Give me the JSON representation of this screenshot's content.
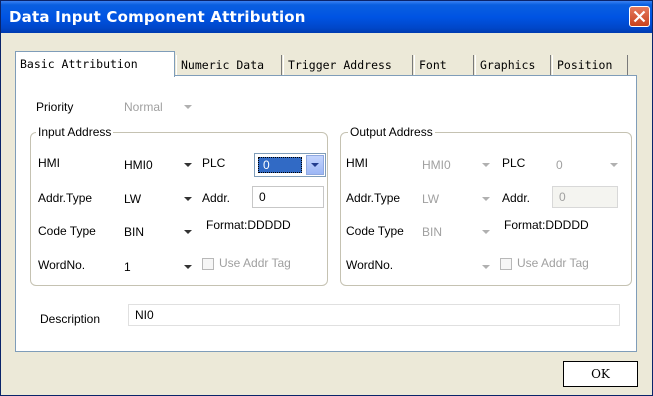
{
  "window": {
    "title": "Data Input Component Attribution"
  },
  "tabs": [
    {
      "label": "Basic Attribution"
    },
    {
      "label": "Numeric Data"
    },
    {
      "label": "Trigger Address"
    },
    {
      "label": "Font"
    },
    {
      "label": "Graphics"
    },
    {
      "label": "Position"
    }
  ],
  "priority": {
    "label": "Priority",
    "value": "Normal"
  },
  "input_address": {
    "legend": "Input Address",
    "hmi_label": "HMI",
    "hmi_value": "HMI0",
    "plc_label": "PLC",
    "plc_value": "0",
    "addr_type_label": "Addr.Type",
    "addr_type_value": "LW",
    "addr_label": "Addr.",
    "addr_value": "0",
    "code_type_label": "Code Type",
    "code_type_value": "BIN",
    "format_text": "Format:DDDDD",
    "word_no_label": "WordNo.",
    "word_no_value": "1",
    "use_addr_tag_label": "Use Addr Tag"
  },
  "output_address": {
    "legend": "Output Address",
    "hmi_label": "HMI",
    "hmi_value": "HMI0",
    "plc_label": "PLC",
    "plc_value": "0",
    "addr_type_label": "Addr.Type",
    "addr_type_value": "LW",
    "addr_label": "Addr.",
    "addr_value": "0",
    "code_type_label": "Code Type",
    "code_type_value": "BIN",
    "format_text": "Format:DDDDD",
    "word_no_label": "WordNo.",
    "word_no_value": "",
    "use_addr_tag_label": "Use Addr Tag"
  },
  "description": {
    "label": "Description",
    "value": "NI0"
  },
  "ok_label": "OK",
  "colors": {
    "titlebar": "#0054e3",
    "selection": "#316ac5",
    "close": "#c8421c"
  }
}
